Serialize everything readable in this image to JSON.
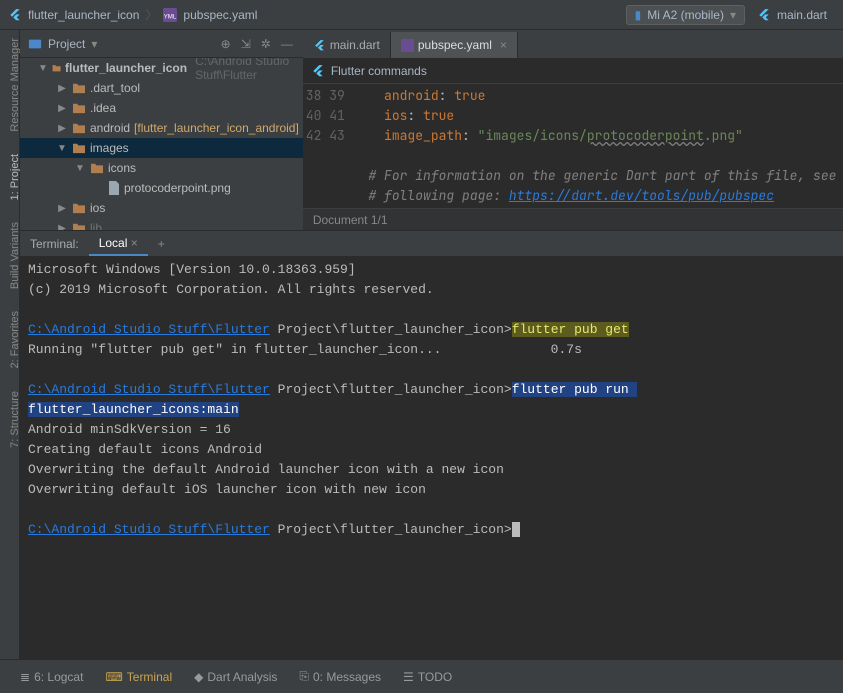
{
  "breadcrumb": {
    "project": "flutter_launcher_icon",
    "file": "pubspec.yaml"
  },
  "device": {
    "label": "Mi A2 (mobile)"
  },
  "runconfig": {
    "label": "main.dart"
  },
  "project_dropdown": "Project",
  "tree": {
    "root": "flutter_launcher_icon",
    "root_path": "C:\\Android Studio Stuff\\Flutter",
    "items": [
      {
        "name": ".dart_tool",
        "type": "folder",
        "indent": 2
      },
      {
        "name": ".idea",
        "type": "folder",
        "indent": 2
      },
      {
        "name": "android",
        "suffix": "[flutter_launcher_icon_android]",
        "type": "folder",
        "indent": 2,
        "hl": true
      },
      {
        "name": "images",
        "type": "folder",
        "indent": 2,
        "open": true,
        "sel": true
      },
      {
        "name": "icons",
        "type": "folder",
        "indent": 3,
        "open": true
      },
      {
        "name": "protocoderpoint.png",
        "type": "file",
        "indent": 4
      },
      {
        "name": "ios",
        "type": "folder",
        "indent": 2
      },
      {
        "name": "lib",
        "type": "folder",
        "indent": 2,
        "partial": true
      }
    ]
  },
  "editor": {
    "tabs": [
      {
        "label": "main.dart",
        "active": false
      },
      {
        "label": "pubspec.yaml",
        "active": true
      }
    ],
    "flutter_bar": "Flutter commands",
    "first_line_no": 38,
    "lines": [
      {
        "n": 38,
        "indent": "    ",
        "key": "android",
        "sep": ": ",
        "val": "true",
        "valclass": "yaml-true"
      },
      {
        "n": 39,
        "indent": "    ",
        "key": "ios",
        "sep": ": ",
        "val": "true",
        "valclass": "yaml-true"
      },
      {
        "n": 40,
        "indent": "    ",
        "key": "image_path",
        "sep": ": ",
        "val": "\"images/icons/protocoderpoint.png\"",
        "valclass": "yaml-val"
      },
      {
        "n": 41,
        "indent": "",
        "blank": true
      },
      {
        "n": 42,
        "comment": "# For information on the generic Dart part of this file, see t"
      },
      {
        "n": 43,
        "comment": "# following page: ",
        "link": "https://dart.dev/tools/pub/pubspec"
      }
    ],
    "status": "Document 1/1"
  },
  "terminal": {
    "tabs": {
      "label": "Terminal:",
      "local": "Local"
    },
    "lines": [
      {
        "t": "Microsoft Windows [Version 10.0.18363.959]"
      },
      {
        "t": "(c) 2019 Microsoft Corporation. All rights reserved."
      },
      {
        "t": ""
      },
      {
        "link": "C:\\Android Studio Stuff\\Flutter",
        "rest": " Project\\flutter_launcher_icon>",
        "cmd": "flutter pub get",
        "cmdclass": "cmd-hl2"
      },
      {
        "t": "Running \"flutter pub get\" in flutter_launcher_icon...              0.7s"
      },
      {
        "t": ""
      },
      {
        "link": "C:\\Android Studio Stuff\\Flutter",
        "rest": " Project\\flutter_launcher_icon>",
        "cmd": "flutter pub run flutter_launcher_icons:main",
        "cmdclass": "cmd-hl"
      },
      {
        "t": "Android minSdkVersion = 16"
      },
      {
        "t": "Creating default icons Android"
      },
      {
        "t": "Overwriting the default Android launcher icon with a new icon"
      },
      {
        "t": "Overwriting default iOS launcher icon with new icon"
      },
      {
        "t": ""
      },
      {
        "link": "C:\\Android Studio Stuff\\Flutter",
        "rest": " Project\\flutter_launcher_icon>",
        "cursor": true
      }
    ]
  },
  "bottombar": {
    "items": [
      {
        "label": "6: Logcat",
        "icon": "logcat"
      },
      {
        "label": "Terminal",
        "icon": "terminal",
        "active": true
      },
      {
        "label": "Dart Analysis",
        "icon": "dart"
      },
      {
        "label": "0: Messages",
        "icon": "messages"
      },
      {
        "label": "TODO",
        "icon": "todo"
      }
    ]
  },
  "left_tabs": [
    "Resource Manager",
    "1: Project",
    "Build Variants",
    "2: Favorites",
    "7: Structure"
  ]
}
